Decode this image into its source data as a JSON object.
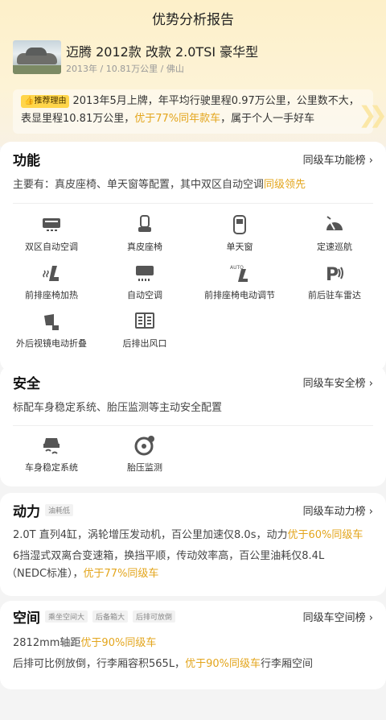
{
  "page": {
    "title": "优势分析报告"
  },
  "car": {
    "name": "迈腾 2012款 改款 2.0TSI 豪华型",
    "meta": "2013年 / 10.81万公里 / 佛山"
  },
  "reason": {
    "tag": "推荐理由",
    "text_before": "2013年5月上牌，年平均行驶里程0.97万公里，公里数不大，表显里程10.81万公里，",
    "highlight": "优于77%同年款车",
    "text_after": "，属于个人一手好车"
  },
  "function": {
    "title": "功能",
    "link": "同级车功能榜 ›",
    "summary_before": "主要有：真皮座椅、单天窗等配置，其中双区自动空调",
    "summary_highlight": "同级领先",
    "items": [
      {
        "label": "双区自动空调",
        "icon": "dual-zone-ac-icon"
      },
      {
        "label": "真皮座椅",
        "icon": "leather-seat-icon"
      },
      {
        "label": "单天窗",
        "icon": "sunroof-icon"
      },
      {
        "label": "定速巡航",
        "icon": "cruise-control-icon"
      },
      {
        "label": "前排座椅加热",
        "icon": "seat-heating-icon"
      },
      {
        "label": "自动空调",
        "icon": "auto-ac-icon"
      },
      {
        "label": "前排座椅电动调节",
        "icon": "power-seat-icon"
      },
      {
        "label": "前后驻车雷达",
        "icon": "parking-radar-icon"
      },
      {
        "label": "外后视镜电动折叠",
        "icon": "mirror-fold-icon"
      },
      {
        "label": "后排出风口",
        "icon": "rear-vent-icon"
      }
    ]
  },
  "safety": {
    "title": "安全",
    "link": "同级车安全榜 ›",
    "summary": "标配车身稳定系统、胎压监测等主动安全配置",
    "items": [
      {
        "label": "车身稳定系统",
        "icon": "stability-control-icon"
      },
      {
        "label": "胎压监测",
        "icon": "tire-pressure-icon"
      }
    ]
  },
  "power": {
    "title": "动力",
    "badge": "油耗低",
    "link": "同级车动力榜 ›",
    "line1_before": "2.0T 直列4缸，涡轮增压发动机，百公里加速仅8.0s，动力",
    "line1_highlight": "优于60%同级车",
    "line2": "6挡湿式双离合变速箱，换挡平顺，传动效率高，百公里油耗仅8.4L",
    "line3_before": "（NEDC标准），",
    "line3_highlight": "优于77%同级车"
  },
  "space": {
    "title": "空间",
    "badges": [
      "乘坐空间大",
      "后备箱大",
      "后排可放倒"
    ],
    "link": "同级车空间榜 ›",
    "line1_before": "2812mm轴距",
    "line1_highlight": "优于90%同级车",
    "line2_before": "后排可比例放倒，行李厢容积565L，",
    "line2_highlight": "优于90%同级车",
    "line2_after": "行李厢空间"
  }
}
